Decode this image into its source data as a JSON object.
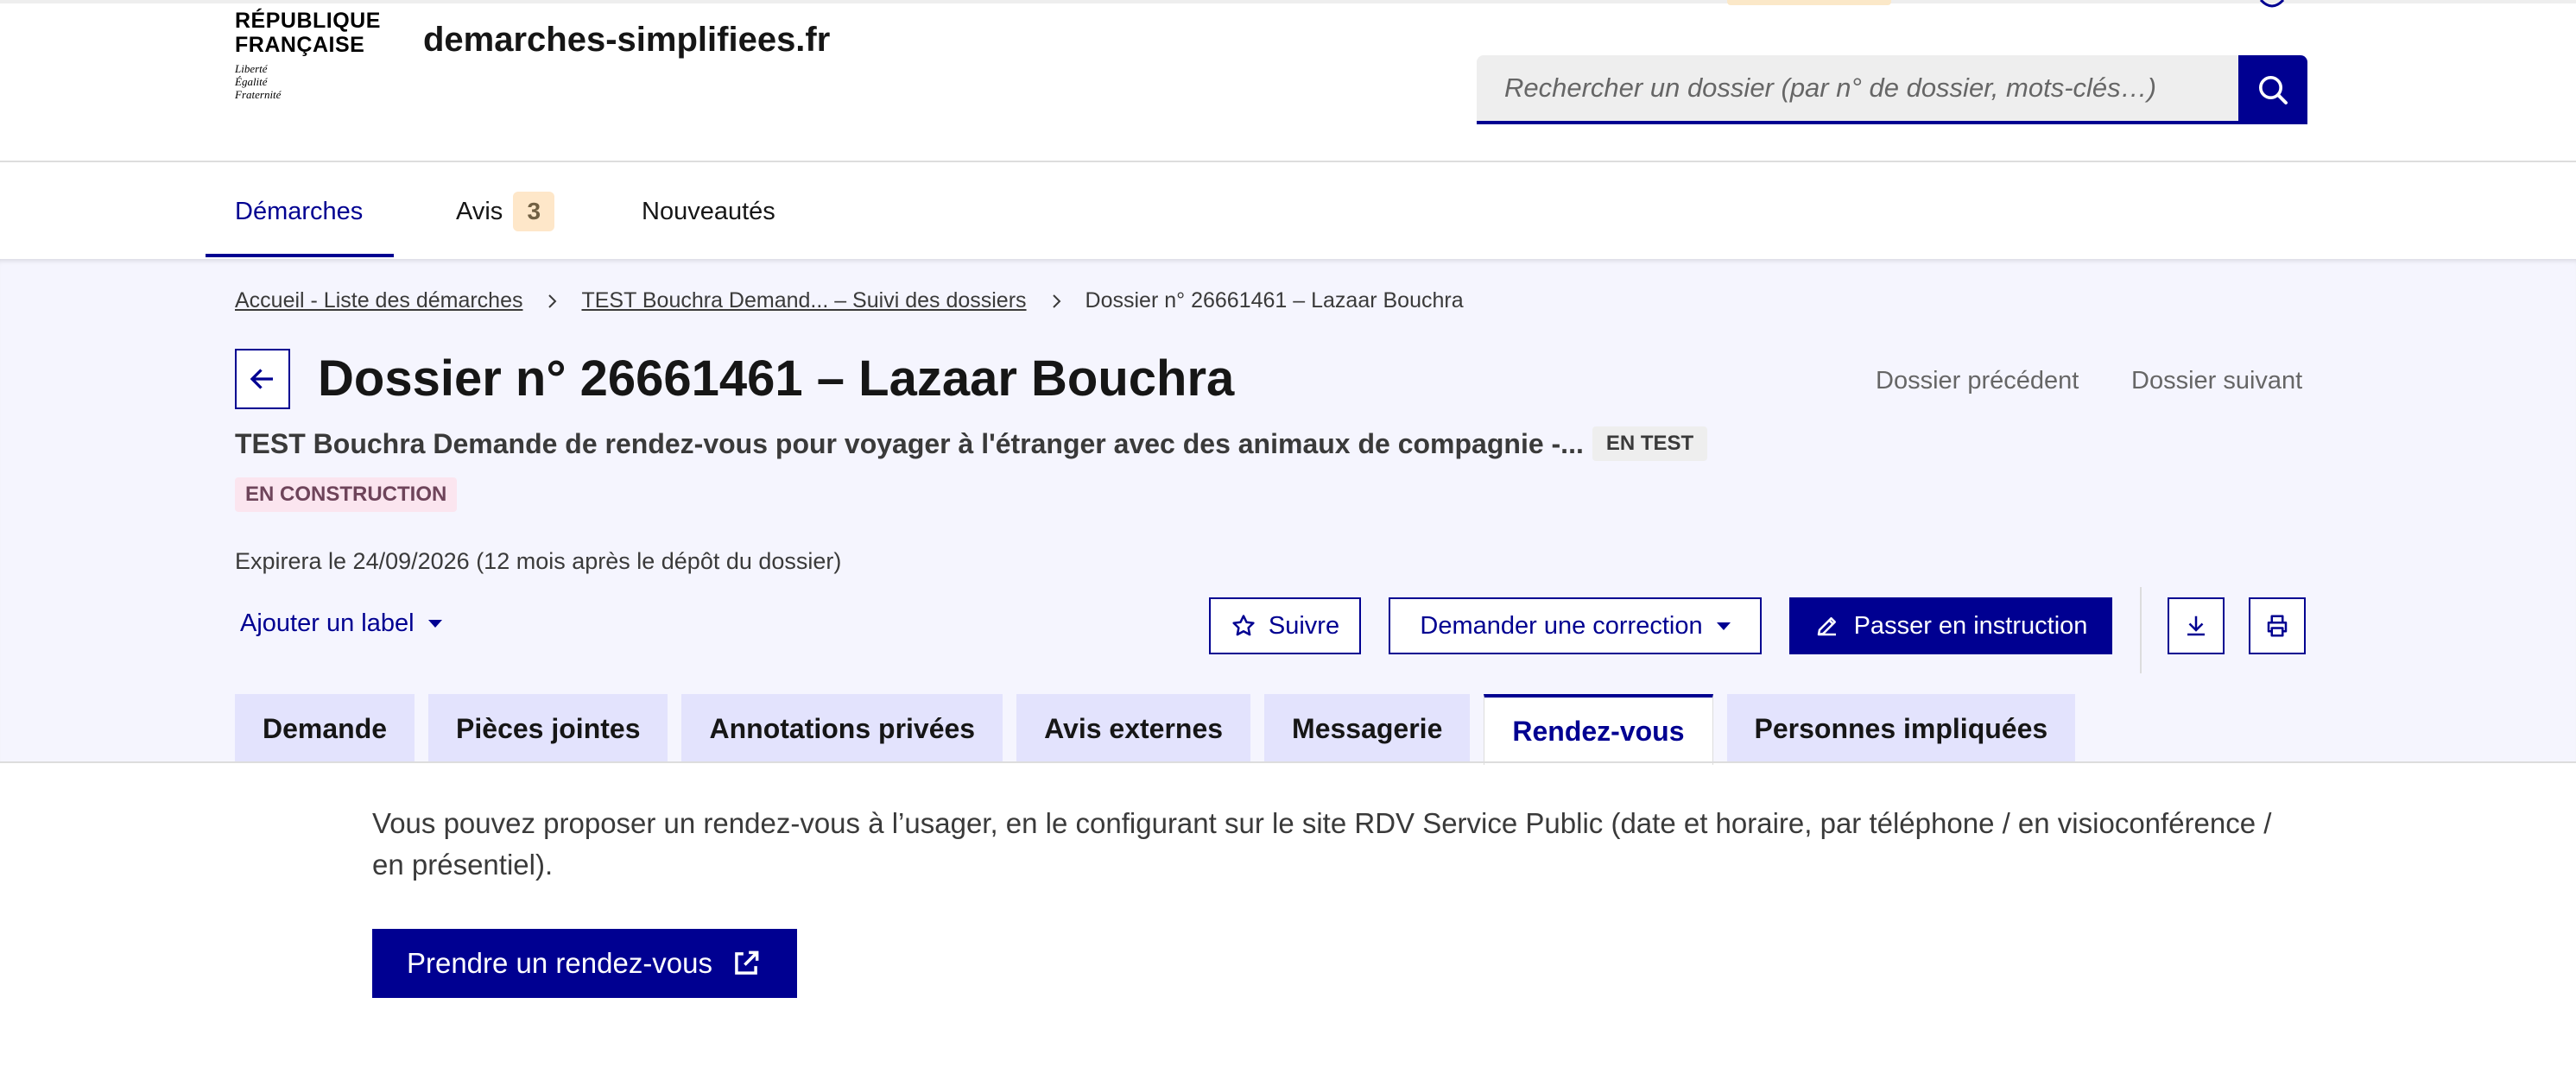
{
  "header": {
    "logo_lines": [
      "RÉPUBLIQUE",
      "FRANÇAISE"
    ],
    "devise_lines": [
      "Liberté",
      "Égalité",
      "Fraternité"
    ],
    "site_name": "demarches-simplifiees.fr",
    "search_placeholder": "Rechercher un dossier (par n° de dossier, mots-clés…)"
  },
  "nav": {
    "items": [
      {
        "label": "Démarches"
      },
      {
        "label": "Avis",
        "badge": "3"
      },
      {
        "label": "Nouveautés"
      }
    ],
    "active": "Démarches"
  },
  "breadcrumb": {
    "items": [
      "Accueil - Liste des démarches",
      "TEST Bouchra Demand... – Suivi des dossiers",
      "Dossier n° 26661461 – Lazaar Bouchra"
    ]
  },
  "dossier": {
    "title": "Dossier n° 26661461 – Lazaar Bouchra",
    "prev_label": "Dossier précédent",
    "next_label": "Dossier suivant",
    "procedure": "TEST Bouchra Demande de rendez-vous pour voyager à l'étranger avec des animaux de compagnie -...",
    "test_tag": "EN TEST",
    "status": "EN CONSTRUCTION",
    "expiry": "Expirera le 24/09/2026 (12 mois après le dépôt du dossier)",
    "add_label": "Ajouter un label"
  },
  "actions": {
    "follow": "Suivre",
    "correction": "Demander une correction",
    "instruction": "Passer en instruction"
  },
  "tabs": [
    "Demande",
    "Pièces jointes",
    "Annotations privées",
    "Avis externes",
    "Messagerie",
    "Rendez-vous",
    "Personnes impliquées"
  ],
  "active_tab": "Rendez-vous",
  "content": {
    "text": "Vous pouvez proposer un rendez-vous à l’usager, en le configurant sur le site RDV Service Public (date et horaire, par téléphone / en visioconférence / en présentiel).",
    "button": "Prendre un rendez-vous"
  },
  "colors": {
    "primary": "#000091",
    "page_bg": "#f5f5fe",
    "tab_bg": "#e3e3fd",
    "badge_bg": "#fee7c9",
    "status_bg": "#fbe5ef"
  },
  "icons": [
    "search-icon",
    "chevron-right-icon",
    "arrow-left-icon",
    "star-icon",
    "pencil-icon",
    "download-icon",
    "printer-icon",
    "external-link-icon",
    "caret-down-icon"
  ]
}
